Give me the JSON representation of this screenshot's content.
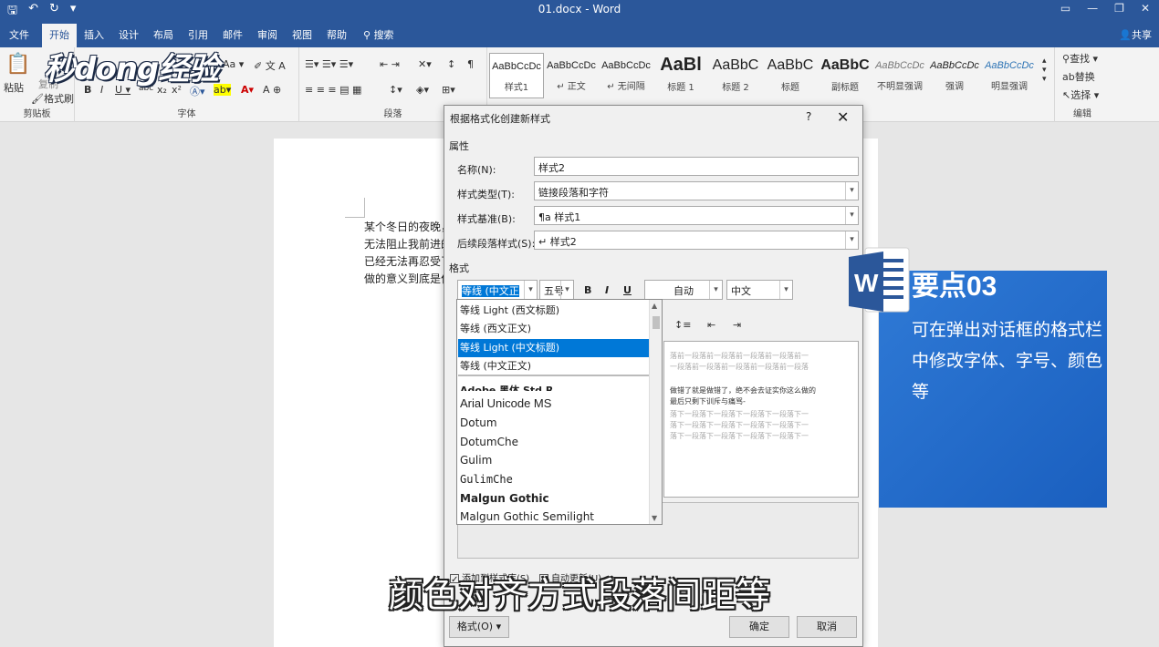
{
  "window": {
    "title": "01.docx - Word"
  },
  "tabs": [
    "文件",
    "开始",
    "插入",
    "设计",
    "布局",
    "引用",
    "邮件",
    "审阅",
    "视图",
    "帮助",
    "搜索"
  ],
  "share_label": "共享",
  "logo": "秒dong经验",
  "ribbon": {
    "clipboard": {
      "paste": "粘贴",
      "copy": "复制",
      "format_painter": "格式刷",
      "label": "剪贴板"
    },
    "font": {
      "label": "字体"
    },
    "paragraph": {
      "label": "段落"
    },
    "styles": [
      {
        "sample": "AaBbCcDc",
        "name": "样式1"
      },
      {
        "sample": "AaBbCcDc",
        "name": "↵ 正文"
      },
      {
        "sample": "AaBbCcDc",
        "name": "↵ 无间隔"
      },
      {
        "sample": "AaBl",
        "name": "标题 1"
      },
      {
        "sample": "AaBbC",
        "name": "标题 2"
      },
      {
        "sample": "AaBbC",
        "name": "标题"
      },
      {
        "sample": "AaBbC",
        "name": "副标题"
      },
      {
        "sample": "AaBbCcDc",
        "name": "不明显强调"
      },
      {
        "sample": "AaBbCcDc",
        "name": "强调"
      },
      {
        "sample": "AaBbCcDc",
        "name": "明显强调"
      }
    ],
    "editing": {
      "find": "查找",
      "replace": "替换",
      "select": "选择",
      "label": "编辑"
    }
  },
  "document": {
    "lines": [
      "某个冬日的夜晚，",
      "无法阻止我前进的",
      "已经无法再忍受了",
      "做的意义到底是什"
    ]
  },
  "dialog": {
    "title": "根据格式化创建新样式",
    "help": "?",
    "section_properties": "属性",
    "name_label": "名称(N):",
    "name_value": "样式2",
    "type_label": "样式类型(T):",
    "type_value": "链接段落和字符",
    "based_label": "样式基准(B):",
    "based_value": "样式1",
    "next_label": "后续段落样式(S):",
    "next_value": "样式2",
    "section_format": "格式",
    "font_value": "等线 (中文正文)",
    "size_value": "五号",
    "bold": "B",
    "italic": "I",
    "underline": "U",
    "color_value": "自动",
    "lang_value": "中文",
    "preview_prev": "落前一段落前一段落前一段落前一段落前一",
    "preview_prev2": "一段落前一段落前一段落前一段落前一段落",
    "preview_main1": "做错了就是做错了，绝不会去证实你这么做的",
    "preview_main2": "最后只剩下训斥与痛骂-",
    "preview_next": "落下一段落下一段落下一段落下一段落下一",
    "add_to_gallery": "添加到样式库(S)",
    "auto_update": "自动更新(U)",
    "format_button": "格式(O)",
    "ok": "确定",
    "cancel": "取消"
  },
  "font_dropdown": {
    "items": [
      "等线 Light (西文标题)",
      "等线 (西文正文)",
      "等线 Light (中文标题)",
      "等线 (中文正文)",
      "Adobe 黑体 Std R",
      "Arial Unicode MS",
      "Dotum",
      "DotumChe",
      "Gulim",
      "GulimChe",
      "Malgun Gothic",
      "Malgun Gothic Semilight"
    ],
    "selected_index": 2
  },
  "card": {
    "title": "要点03",
    "text": "可在弹出对话框的格式栏中修改字体、字号、颜色等"
  },
  "subtitle": "颜色对齐方式段落间距等",
  "colors": {
    "brand": "#2b579a",
    "accent": "#1a5fbf",
    "highlight": "#0078d7"
  }
}
